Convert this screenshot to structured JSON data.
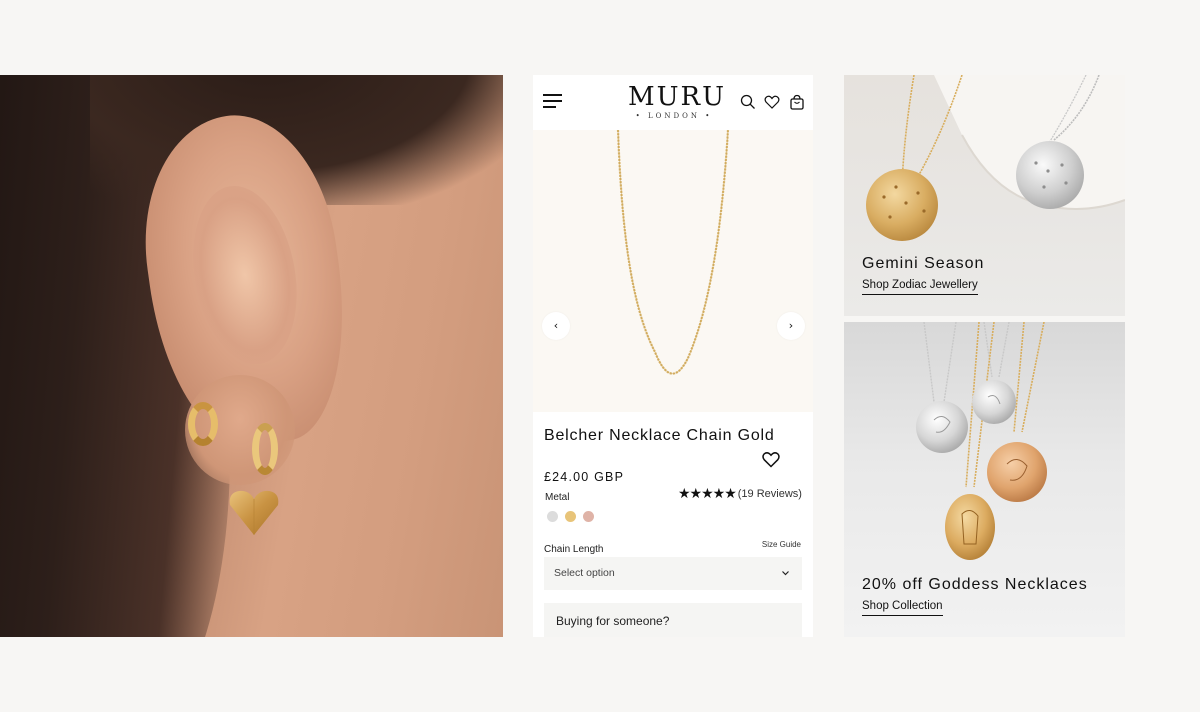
{
  "brand": {
    "name": "MURU",
    "sub": "• LONDON •"
  },
  "header_icons": [
    "menu-icon",
    "search-icon",
    "heart-icon",
    "bag-icon"
  ],
  "gallery": {
    "prev": "‹",
    "next": "›"
  },
  "product": {
    "title": "Belcher Necklace Chain Gold",
    "price": "£24.00 GBP",
    "stars": "★★★★★",
    "reviews": "(19 Reviews)",
    "rating": 5,
    "metal_label": "Metal",
    "metal_swatches": [
      "#dcdcdc",
      "#e8c479",
      "#dfb3a7"
    ],
    "chain_length_label": "Chain Length",
    "size_guide": "Size Guide",
    "select_placeholder": "Select option",
    "gift_label": "Buying for someone?"
  },
  "promos": [
    {
      "title": "Gemini Season",
      "link": "Shop Zodiac Jewellery"
    },
    {
      "title": "20% off Goddess Necklaces",
      "link": "Shop Collection"
    }
  ],
  "colors": {
    "background": "#f7f6f4",
    "gold": "#d4a04a",
    "text": "#111111"
  }
}
